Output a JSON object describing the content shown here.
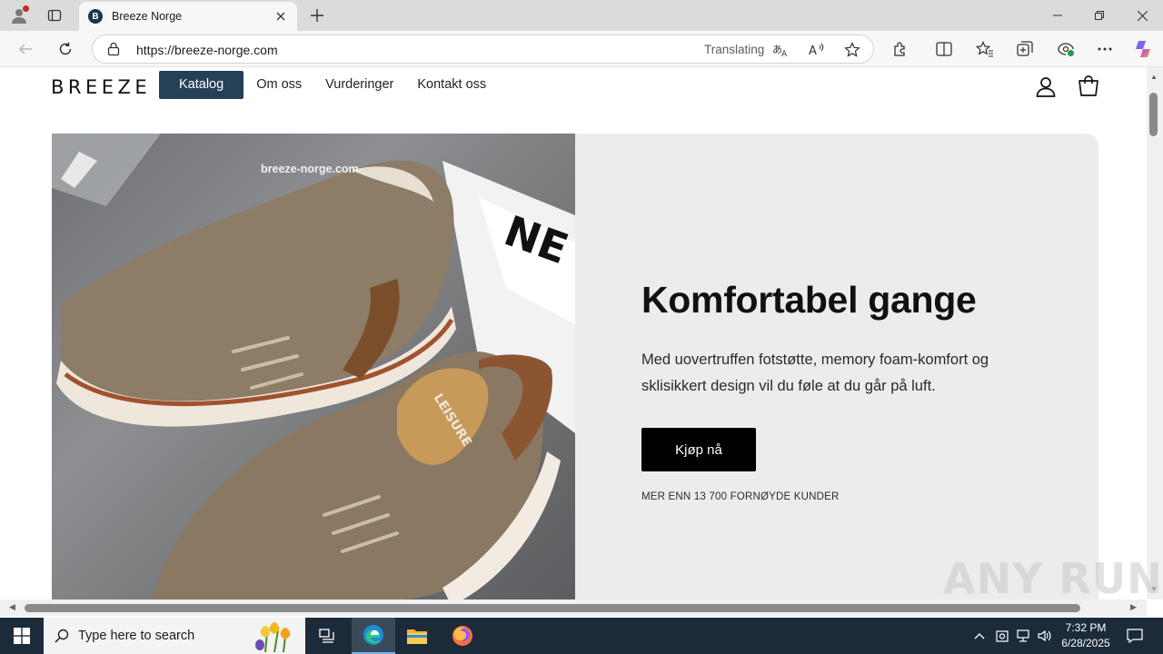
{
  "browser": {
    "tab_title": "Breeze Norge",
    "tab_favicon_letter": "B",
    "url": "https://breeze-norge.com",
    "translating_label": "Translating"
  },
  "site": {
    "logo": "BREEZE",
    "nav": [
      "Katalog",
      "Om oss",
      "Vurderinger",
      "Kontakt oss"
    ],
    "hero": {
      "image_watermark": "breeze-norge.com",
      "title": "Komfortabel gange",
      "text": "Med uovertruffen fotstøtte, memory foam-komfort og sklisikkert design vil du føle at du går på luft.",
      "cta": "Kjøp nå",
      "social_proof": "MER ENN 13 700 FORNØYDE KUNDER"
    }
  },
  "overlay": {
    "watermark": "ANY RUN"
  },
  "taskbar": {
    "search_placeholder": "Type here to search",
    "time": "7:32 PM",
    "date": "6/28/2025"
  },
  "colors": {
    "nav_active_bg": "#264057",
    "cta_bg": "#000000",
    "hero_bg": "#ececec",
    "taskbar_bg": "#1c2b3a"
  }
}
